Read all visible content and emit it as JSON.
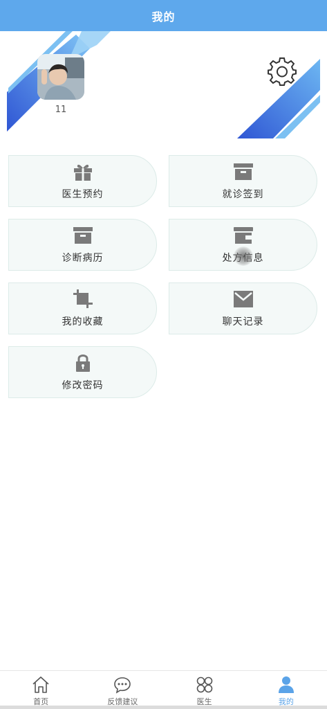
{
  "header": {
    "title": "我的"
  },
  "profile": {
    "username": "11"
  },
  "menu": [
    {
      "label": "医生预约",
      "icon": "gift-icon"
    },
    {
      "label": "就诊签到",
      "icon": "archive-icon"
    },
    {
      "label": "诊断病历",
      "icon": "archive-icon"
    },
    {
      "label": "处方信息",
      "icon": "wallet-icon"
    },
    {
      "label": "我的收藏",
      "icon": "crop-icon"
    },
    {
      "label": "聊天记录",
      "icon": "mail-icon"
    },
    {
      "label": "修改密码",
      "icon": "lock-icon"
    }
  ],
  "nav": [
    {
      "label": "首页",
      "icon": "home-icon",
      "active": false
    },
    {
      "label": "反馈建议",
      "icon": "chat-icon",
      "active": false
    },
    {
      "label": "医生",
      "icon": "grid-icon",
      "active": false
    },
    {
      "label": "我的",
      "icon": "user-icon",
      "active": true
    }
  ],
  "colors": {
    "header": "#5ea8ec",
    "accent": "#5aa3e8",
    "icon": "#7a7a7a",
    "deco": "#3a63d8"
  }
}
